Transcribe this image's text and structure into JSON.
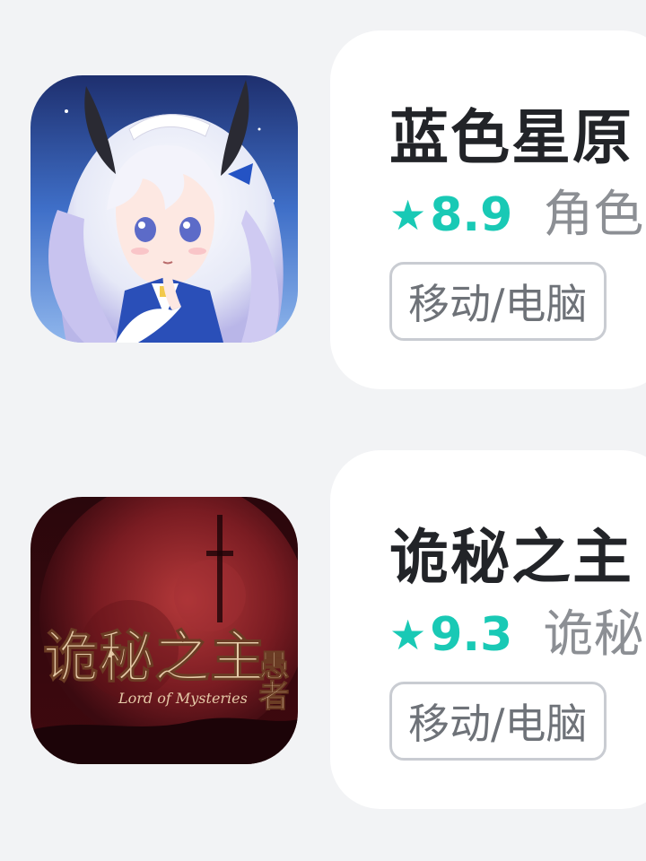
{
  "games": [
    {
      "title": "蓝色星原",
      "star_icon": "★",
      "rating": "8.9",
      "genre": "角色",
      "tag": "移动/电脑",
      "icon": "anime-girl-game-icon"
    },
    {
      "title": "诡秘之主",
      "star_icon": "★",
      "rating": "9.3",
      "genre": "诡秘",
      "tag": "移动/电脑",
      "icon": "lord-of-mysteries-game-icon",
      "icon_text": {
        "main": "诡秘之主",
        "side": "愚者",
        "english": "Lord of Mysteries"
      }
    }
  ],
  "colors": {
    "accent": "#19c9b5",
    "background": "#f2f3f5",
    "card": "#ffffff"
  }
}
